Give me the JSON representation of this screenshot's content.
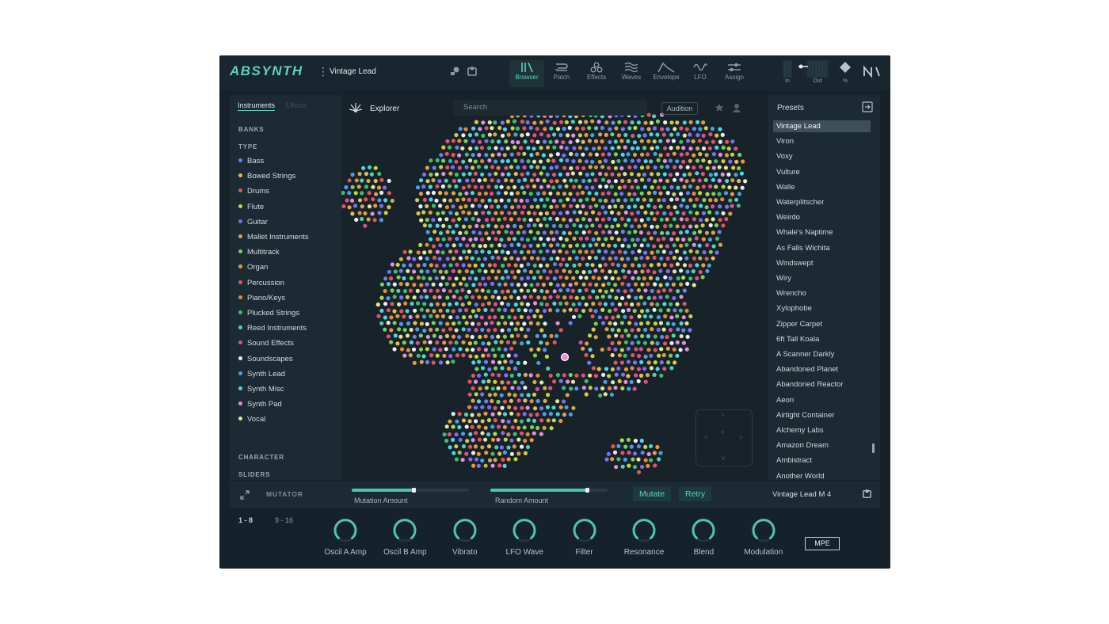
{
  "app": {
    "logo": "ABSYNTH",
    "current_preset": "Vintage Lead"
  },
  "top_tabs": [
    {
      "label": "Browser",
      "icon": "browser-icon"
    },
    {
      "label": "Patch",
      "icon": "patch-icon"
    },
    {
      "label": "Effects",
      "icon": "effects-icon"
    },
    {
      "label": "Waves",
      "icon": "waves-icon"
    },
    {
      "label": "Envelope",
      "icon": "envelope-icon"
    },
    {
      "label": "LFO",
      "icon": "lfo-icon"
    },
    {
      "label": "Assign",
      "icon": "assign-icon"
    }
  ],
  "meters": {
    "in_label": "In",
    "out_label": "Out",
    "percent_label": "%"
  },
  "left": {
    "tab_instruments": "Instruments",
    "tab_effects": "Effects",
    "banks_label": "BANKS",
    "type_label": "TYPE",
    "types": [
      {
        "label": "Bass",
        "color": "#6f7ef0"
      },
      {
        "label": "Bowed Strings",
        "color": "#e3c24a"
      },
      {
        "label": "Drums",
        "color": "#e2545e"
      },
      {
        "label": "Flute",
        "color": "#b9d84a"
      },
      {
        "label": "Guitar",
        "color": "#7a6ff0"
      },
      {
        "label": "Mallet Instruments",
        "color": "#d8a64e"
      },
      {
        "label": "Multitrack",
        "color": "#7ccf5b"
      },
      {
        "label": "Organ",
        "color": "#e59a3c"
      },
      {
        "label": "Percussion",
        "color": "#e2545e"
      },
      {
        "label": "Piano/Keys",
        "color": "#e58a3c"
      },
      {
        "label": "Plucked Strings",
        "color": "#3fbf6e"
      },
      {
        "label": "Reed Instruments",
        "color": "#4fd0c0"
      },
      {
        "label": "Sound Effects",
        "color": "#e0508a"
      },
      {
        "label": "Soundscapes",
        "color": "#e9eef0"
      },
      {
        "label": "Synth Lead",
        "color": "#4a9ee8"
      },
      {
        "label": "Synth Misc",
        "color": "#4fd6e6"
      },
      {
        "label": "Synth Pad",
        "color": "#e58fe0"
      },
      {
        "label": "Vocal",
        "color": "#e6e59a"
      }
    ],
    "character_label": "CHARACTER",
    "sliders_label": "SLIDERS"
  },
  "center": {
    "explorer_label": "Explorer",
    "search_placeholder": "Search",
    "audition_label": "Audition"
  },
  "presets": {
    "label": "Presets",
    "items": [
      "Vintage Lead",
      "Viron",
      "Voxy",
      "Vulture",
      "Walle",
      "Waterplitscher",
      "Weirdo",
      "Whale's Naptime",
      "As Falls Wichita",
      "Windswept",
      "Wiry",
      "Wrencho",
      "Xylophobe",
      "Zipper Carpet",
      "6ft Tall Koala",
      "A Scanner Darkly",
      "Abandoned Planet",
      "Abandoned Reactor",
      "Aeon",
      "Airtight Container",
      "Alchemy Labs",
      "Amazon Dream",
      "Ambistract",
      "Another World"
    ],
    "selected": "Vintage Lead"
  },
  "mutator": {
    "label": "MUTATOR",
    "mutation_amount_label": "Mutation Amount",
    "mutation_amount": 0.53,
    "random_amount_label": "Random Amount",
    "random_amount": 0.83,
    "mutate_label": "Mutate",
    "retry_label": "Retry",
    "result_preset": "Vintage Lead M 4"
  },
  "macros": {
    "page_1": "1 - 8",
    "page_2": "9 - 16",
    "knobs": [
      {
        "label": "Oscil A Amp"
      },
      {
        "label": "Oscil B Amp"
      },
      {
        "label": "Vibrato"
      },
      {
        "label": "LFO Wave"
      },
      {
        "label": "Filter"
      },
      {
        "label": "Resonance"
      },
      {
        "label": "Blend"
      },
      {
        "label": "Modulation"
      }
    ],
    "mpe_label": "MPE"
  },
  "colors": {
    "accent": "#5fd0c0",
    "background": "#16222b"
  }
}
